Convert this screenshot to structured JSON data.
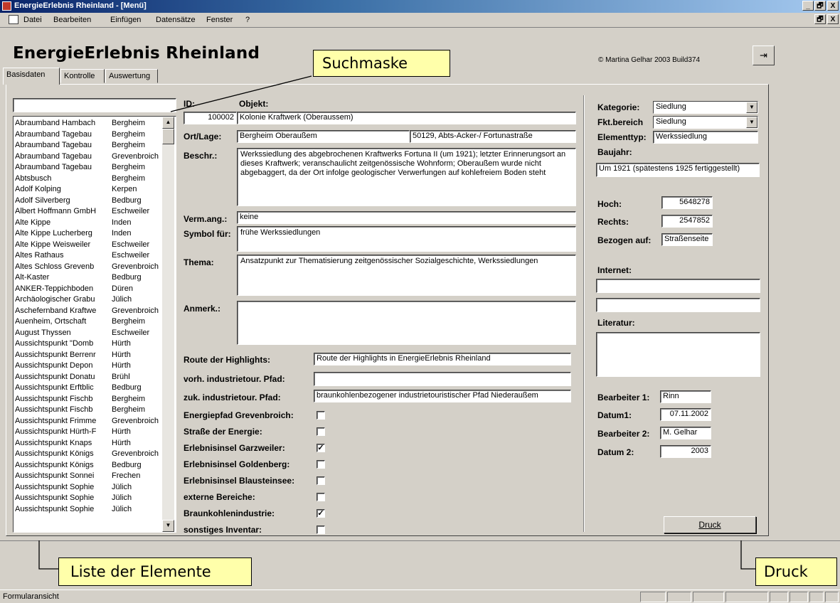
{
  "window": {
    "title": "EnergieErlebnis Rheinland - [Menü]",
    "controls": [
      "_",
      "🗗",
      "X"
    ],
    "inner_controls": [
      "🗗",
      "X"
    ]
  },
  "menu": [
    "Datei",
    "Bearbeiten",
    "Einfügen",
    "Datensätze",
    "Fenster",
    "?"
  ],
  "app_title": "EnergieErlebnis Rheinland",
  "copyright": "© Martina Gelhar 2003 Build374",
  "tabs": [
    "Basisdaten",
    "Kontrolle",
    "Auswertung"
  ],
  "search": {
    "value": ""
  },
  "list_items": [
    [
      "Abraumband Hambach",
      "Bergheim"
    ],
    [
      "Abraumband Tagebau",
      "Bergheim"
    ],
    [
      "Abraumband Tagebau",
      "Bergheim"
    ],
    [
      "Abraumband Tagebau",
      "Grevenbroich"
    ],
    [
      "Abraumband Tagebau",
      "Bergheim"
    ],
    [
      "Abtsbusch",
      "Bergheim"
    ],
    [
      "Adolf Kolping",
      "Kerpen"
    ],
    [
      "Adolf Silverberg",
      "Bedburg"
    ],
    [
      "Albert Hoffmann GmbH",
      "Eschweiler"
    ],
    [
      "Alte Kippe",
      "Inden"
    ],
    [
      "Alte Kippe Lucherberg",
      "Inden"
    ],
    [
      "Alte Kippe Weisweiler",
      "Eschweiler"
    ],
    [
      "Altes Rathaus",
      "Eschweiler"
    ],
    [
      "Altes Schloss Grevenb",
      "Grevenbroich"
    ],
    [
      "Alt-Kaster",
      "Bedburg"
    ],
    [
      "ANKER-Teppichboden",
      "Düren"
    ],
    [
      "Archäologischer Grabu",
      "Jülich"
    ],
    [
      "Aschefernband Kraftwe",
      "Grevenbroich"
    ],
    [
      "Auenheim, Ortschaft",
      "Bergheim"
    ],
    [
      "August Thyssen",
      "Eschweiler"
    ],
    [
      "Aussichtspunkt \"Domb",
      "Hürth"
    ],
    [
      "Aussichtspunkt Berrenr",
      "Hürth"
    ],
    [
      "Aussichtspunkt Depon",
      "Hürth"
    ],
    [
      "Aussichtspunkt Donatu",
      "Brühl"
    ],
    [
      "Aussichtspunkt Erftblic",
      "Bedburg"
    ],
    [
      "Aussichtspunkt Fischb",
      "Bergheim"
    ],
    [
      "Aussichtspunkt Fischb",
      "Bergheim"
    ],
    [
      "Aussichtspunkt Frimme",
      "Grevenbroich"
    ],
    [
      "Aussichtspunkt Hürth-F",
      "Hürth"
    ],
    [
      "Aussichtspunkt Knaps",
      "Hürth"
    ],
    [
      "Aussichtspunkt Königs",
      "Grevenbroich"
    ],
    [
      "Aussichtspunkt Königs",
      "Bedburg"
    ],
    [
      "Aussichtspunkt Sonnei",
      "Frechen"
    ],
    [
      "Aussichtspunkt Sophie",
      "Jülich"
    ],
    [
      "Aussichtspunkt Sophie",
      "Jülich"
    ],
    [
      "Aussichtspunkt Sophie",
      "Jülich"
    ]
  ],
  "labels": {
    "id": "ID:",
    "objekt": "Objekt:",
    "ort": "Ort/Lage:",
    "beschr": "Beschr.:",
    "verm": "Verm.ang.:",
    "symbol": "Symbol für:",
    "thema": "Thema:",
    "anmerk": "Anmerk.:",
    "route": "Route der Highlights:",
    "vorh": "vorh. industrietour. Pfad:",
    "zuk": "zuk. industrietour. Pfad:",
    "kategorie": "Kategorie:",
    "fktbereich": "Fkt.bereich",
    "elementtyp": "Elementtyp:",
    "baujahr": "Baujahr:",
    "hoch": "Hoch:",
    "rechts": "Rechts:",
    "bezogen": "Bezogen auf:",
    "internet": "Internet:",
    "literatur": "Literatur:",
    "bearbeiter1": "Bearbeiter 1:",
    "datum1": "Datum1:",
    "bearbeiter2": "Bearbeiter 2:",
    "datum2": "Datum 2:"
  },
  "fields": {
    "id": "100002",
    "objekt": "Kolonie Kraftwerk (Oberaussem)",
    "ort": "Bergheim Oberaußem",
    "adresse": "50129, Abts-Acker-/ Fortunastraße",
    "beschr": "Werkssiedlung des abgebrochenen Kraftwerks Fortuna II (um 1921); letzter Erinnerungsort an dieses Kraftwerk; veranschaulicht zeitgenössische Wohnform; Oberaußem wurde nicht abgebaggert, da der Ort infolge geologischer Verwerfungen auf kohlefreiem Boden steht",
    "verm": "keine",
    "symbol": "frühe Werkssiedlungen",
    "thema": "Ansatzpunkt zur Thematisierung zeitgenössischer Sozialgeschichte, Werkssiedlungen",
    "anmerk": "",
    "route": "Route der Highlights in EnergieErlebnis Rheinland",
    "vorh": "",
    "zuk": "braunkohlenbezogener industrietouristischer Pfad Niederaußem",
    "kategorie": "Siedlung",
    "fktbereich": "Siedlung",
    "elementtyp": "Werkssiedlung",
    "baujahr": "Um 1921 (spätestens 1925 fertiggestellt)",
    "hoch": "5648278",
    "rechts": "2547852",
    "bezogen": "Straßenseite",
    "internet1": "",
    "internet2": "",
    "literatur": "",
    "bearbeiter1": "Rinn",
    "datum1": "07.11.2002",
    "bearbeiter2": "M. Gelhar",
    "datum2": "2003"
  },
  "checkboxes": [
    {
      "label": "Energiepfad Grevenbroich:",
      "checked": false
    },
    {
      "label": "Straße der Energie:",
      "checked": false
    },
    {
      "label": "Erlebnisinsel Garzweiler:",
      "checked": true
    },
    {
      "label": "Erlebnisinsel Goldenberg:",
      "checked": false
    },
    {
      "label": "Erlebnisinsel Blausteinsee:",
      "checked": false
    },
    {
      "label": "externe Bereiche:",
      "checked": false
    },
    {
      "label": "Braunkohlenindustrie:",
      "checked": true
    },
    {
      "label": "sonstiges Inventar:",
      "checked": false
    }
  ],
  "druck_button": "Druck",
  "callouts": {
    "suchmaske": "Suchmaske",
    "liste": "Liste der Elemente",
    "druck": "Druck"
  },
  "status": "Formularansicht"
}
